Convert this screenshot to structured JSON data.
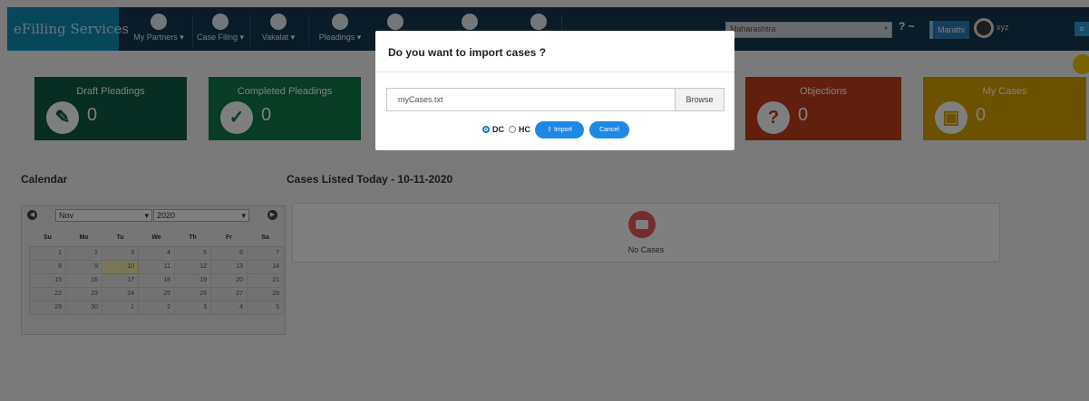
{
  "navbar": {
    "brand": "eFilling Services",
    "items": [
      {
        "label": "My Partners",
        "icon": "partners-icon"
      },
      {
        "label": "Case Filing",
        "icon": "pencil-icon"
      },
      {
        "label": "Vakalat",
        "icon": "document-icon"
      },
      {
        "label": "Pleadings",
        "icon": "pleadings-icon"
      },
      {
        "label": "",
        "icon": "rupee-icon"
      },
      {
        "label": "",
        "icon": "book-icon"
      },
      {
        "label": "",
        "icon": "lock-icon"
      }
    ],
    "state_select": "Maharashtra",
    "help": "? ~",
    "language": "Marathi",
    "user": "xyz"
  },
  "tiles": [
    {
      "title": "Draft Pleadings",
      "value": "0",
      "icon": "edit-icon",
      "color": "#0f5c44",
      "icon_color": "#0f5c44"
    },
    {
      "title": "Completed Pleadings",
      "value": "0",
      "icon": "check-icon",
      "color": "#0f7a4a",
      "icon_color": "#0f7a4a"
    },
    {
      "title": "Objections",
      "value": "0",
      "icon": "question-icon",
      "color": "#c0401a",
      "icon_color": "#c0401a"
    },
    {
      "title": "My Cases",
      "value": "0",
      "icon": "briefcase-icon",
      "color": "#d9a300",
      "icon_color": "#d9a300"
    }
  ],
  "calendar": {
    "title": "Calendar",
    "month": "Nov",
    "year": "2020",
    "weekdays": [
      "Su",
      "Mo",
      "Tu",
      "We",
      "Th",
      "Fr",
      "Sa"
    ],
    "weeks": [
      [
        "1",
        "2",
        "3",
        "4",
        "5",
        "6",
        "7"
      ],
      [
        "8",
        "9",
        "10",
        "11",
        "12",
        "13",
        "14"
      ],
      [
        "15",
        "16",
        "17",
        "18",
        "19",
        "20",
        "21"
      ],
      [
        "22",
        "23",
        "24",
        "25",
        "26",
        "27",
        "28"
      ],
      [
        "29",
        "30",
        "1",
        "2",
        "3",
        "4",
        "5"
      ]
    ],
    "today": "10"
  },
  "cases_listed": {
    "title": "Cases Listed Today - 10-11-2020",
    "empty_text": "No Cases"
  },
  "modal": {
    "title": "Do you want to import cases ?",
    "file_value": "myCases.txt",
    "browse_label": "Browse",
    "options": [
      {
        "label": "DC",
        "checked": true
      },
      {
        "label": "HC",
        "checked": false
      }
    ],
    "import_label": "Import",
    "cancel_label": "Cancel"
  }
}
